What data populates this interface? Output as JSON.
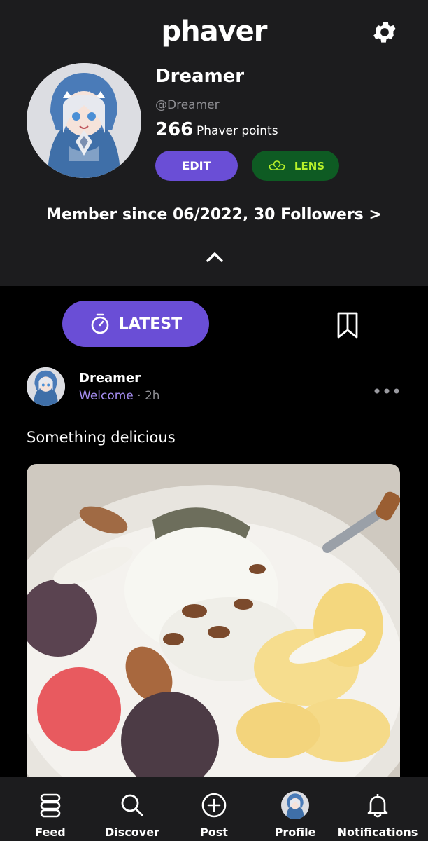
{
  "header": {
    "brand": "phaver",
    "settings_icon": "gear-icon"
  },
  "profile": {
    "name": "Dreamer",
    "handle": "@Dreamer",
    "points": "266",
    "points_label": "Phaver points",
    "edit_label": "EDIT",
    "lens_label": "LENS",
    "member_line": "Member since 06/2022, 30 Followers >"
  },
  "tabs": {
    "latest_label": "LATEST",
    "latest_icon": "stopwatch-icon",
    "bookmark_icon": "bookmark-icon"
  },
  "post": {
    "author": "Dreamer",
    "community": "Welcome",
    "separator": "·",
    "time": "2h",
    "text": "Something delicious"
  },
  "nav": {
    "items": [
      {
        "label": "Feed",
        "icon": "stack-icon"
      },
      {
        "label": "Discover",
        "icon": "search-icon"
      },
      {
        "label": "Post",
        "icon": "plus-circle-icon"
      },
      {
        "label": "Profile",
        "icon": "avatar-icon"
      },
      {
        "label": "Notifications",
        "icon": "bell-icon"
      }
    ]
  },
  "colors": {
    "accent": "#6a4ed6",
    "lens_bg": "#0e5b23",
    "lens_text": "#b8f12a",
    "card_bg": "#1c1c1e",
    "community": "#a48cf0"
  }
}
